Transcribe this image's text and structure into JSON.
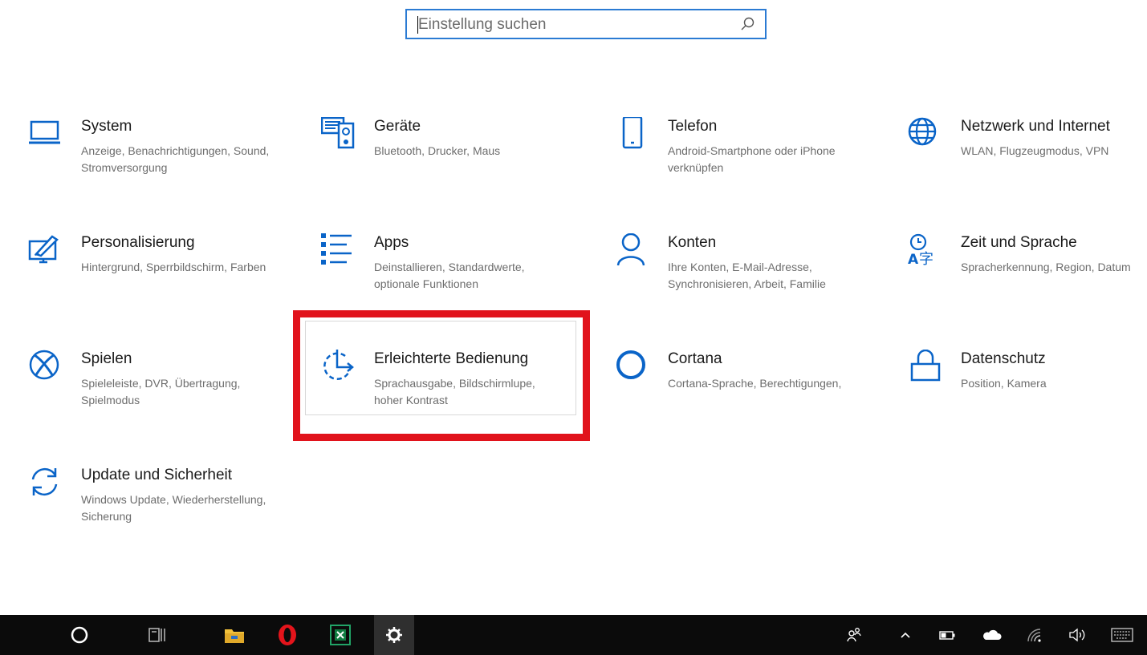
{
  "search": {
    "placeholder": "Einstellung suchen",
    "icon": "search-icon"
  },
  "tiles": [
    {
      "title": "System",
      "desc": "Anzeige, Benachrichtigungen, Sound, Stromversorgung",
      "icon": "laptop-icon"
    },
    {
      "title": "Geräte",
      "desc": "Bluetooth, Drucker, Maus",
      "icon": "devices-icon"
    },
    {
      "title": "Telefon",
      "desc": "Android-Smartphone oder iPhone verknüpfen",
      "icon": "phone-icon"
    },
    {
      "title": "Netzwerk und Internet",
      "desc": "WLAN, Flugzeugmodus, VPN",
      "icon": "globe-icon"
    },
    {
      "title": "Personalisierung",
      "desc": "Hintergrund, Sperrbildschirm, Farben",
      "icon": "personalization-icon"
    },
    {
      "title": "Apps",
      "desc": "Deinstallieren, Standardwerte, optionale Funktionen",
      "icon": "apps-list-icon"
    },
    {
      "title": "Konten",
      "desc": "Ihre Konten, E-Mail-Adresse, Synchronisieren, Arbeit, Familie",
      "icon": "person-icon"
    },
    {
      "title": "Zeit und Sprache",
      "desc": "Spracherkennung, Region, Datum",
      "icon": "time-language-icon"
    },
    {
      "title": "Spielen",
      "desc": "Spieleleiste, DVR, Übertragung, Spielmodus",
      "icon": "xbox-icon"
    },
    {
      "title": "Erleichterte Bedienung",
      "desc": "Sprachausgabe, Bildschirmlupe, hoher Kontrast",
      "icon": "ease-of-access-icon"
    },
    {
      "title": "Cortana",
      "desc": "Cortana-Sprache, Berechtigungen,",
      "icon": "cortana-icon"
    },
    {
      "title": "Datenschutz",
      "desc": "Position, Kamera",
      "icon": "lock-icon"
    },
    {
      "title": "Update und Sicherheit",
      "desc": "Windows Update, Wiederherstellung, Sicherung",
      "icon": "sync-icon"
    }
  ],
  "taskbar": {
    "items": [
      "cortana-circle-icon",
      "task-view-icon",
      "file-explorer-icon",
      "opera-icon",
      "excel-icon",
      "settings-gear-icon"
    ],
    "tray": [
      "people-icon",
      "chevron-up-icon",
      "battery-icon",
      "onedrive-icon",
      "wifi-icon",
      "volume-icon",
      "keyboard-icon"
    ]
  },
  "colors": {
    "accent": "#0a64c8",
    "highlight": "#e1131c",
    "taskbar": "#0b0b0b"
  }
}
